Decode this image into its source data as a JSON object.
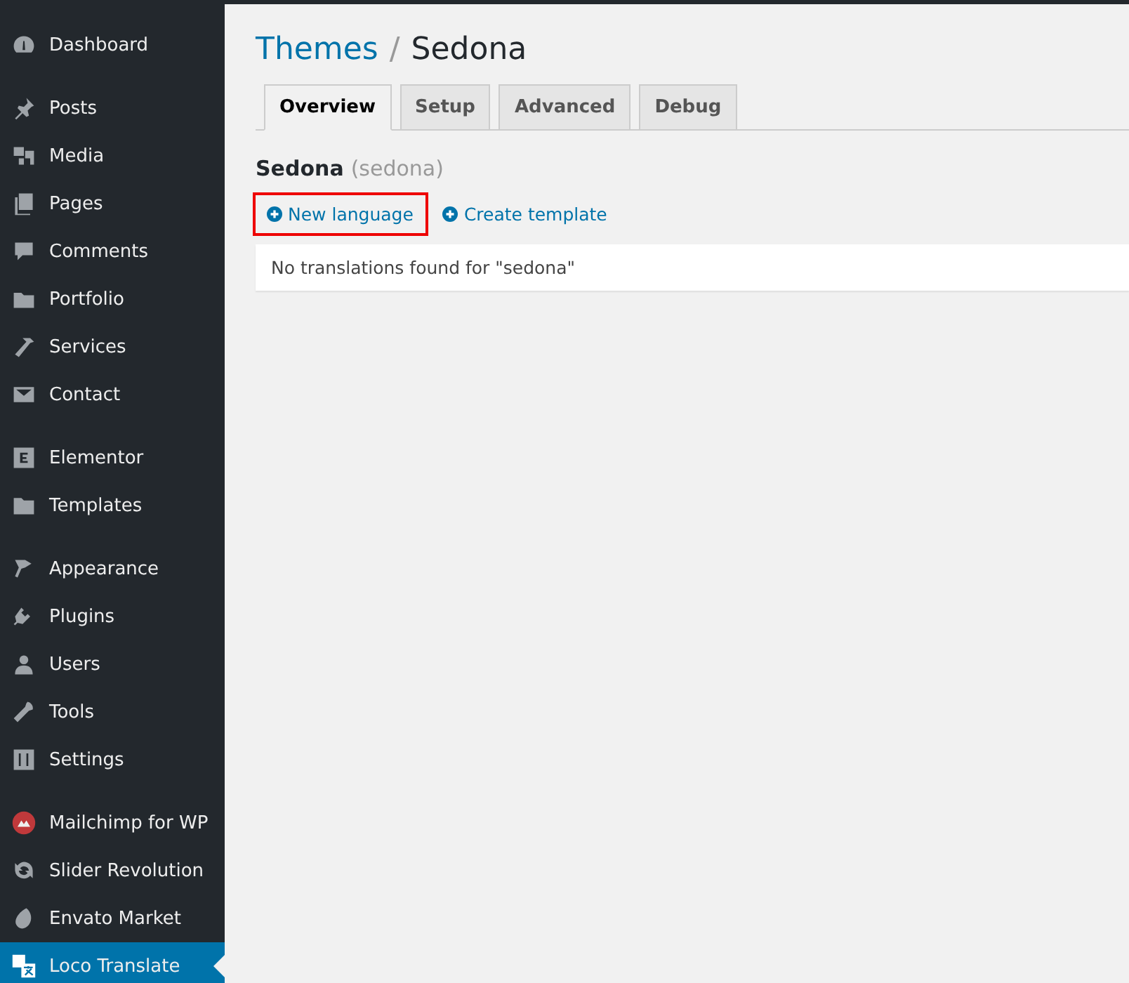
{
  "sidebar": {
    "groups": [
      [
        {
          "label": "Dashboard",
          "selected": false
        }
      ],
      [
        {
          "label": "Posts",
          "selected": false
        },
        {
          "label": "Media",
          "selected": false
        },
        {
          "label": "Pages",
          "selected": false
        },
        {
          "label": "Comments",
          "selected": false
        },
        {
          "label": "Portfolio",
          "selected": false
        },
        {
          "label": "Services",
          "selected": false
        },
        {
          "label": "Contact",
          "selected": false
        }
      ],
      [
        {
          "label": "Elementor",
          "selected": false
        },
        {
          "label": "Templates",
          "selected": false
        }
      ],
      [
        {
          "label": "Appearance",
          "selected": false
        },
        {
          "label": "Plugins",
          "selected": false
        },
        {
          "label": "Users",
          "selected": false
        },
        {
          "label": "Tools",
          "selected": false
        },
        {
          "label": "Settings",
          "selected": false
        }
      ],
      [
        {
          "label": "Mailchimp for WP",
          "selected": false
        },
        {
          "label": "Slider Revolution",
          "selected": false
        },
        {
          "label": "Envato Market",
          "selected": false
        },
        {
          "label": "Loco Translate",
          "selected": true
        }
      ]
    ]
  },
  "breadcrumb": {
    "parent": "Themes",
    "separator": "/",
    "current": "Sedona"
  },
  "tabs": [
    {
      "label": "Overview",
      "selected": true
    },
    {
      "label": "Setup",
      "selected": false
    },
    {
      "label": "Advanced",
      "selected": false
    },
    {
      "label": "Debug",
      "selected": false
    }
  ],
  "bundle": {
    "name": "Sedona",
    "slug": "(sedona)"
  },
  "actions": [
    {
      "label": "New language",
      "highlighted": true
    },
    {
      "label": "Create template",
      "highlighted": false
    }
  ],
  "notice": "No translations found for \"sedona\""
}
